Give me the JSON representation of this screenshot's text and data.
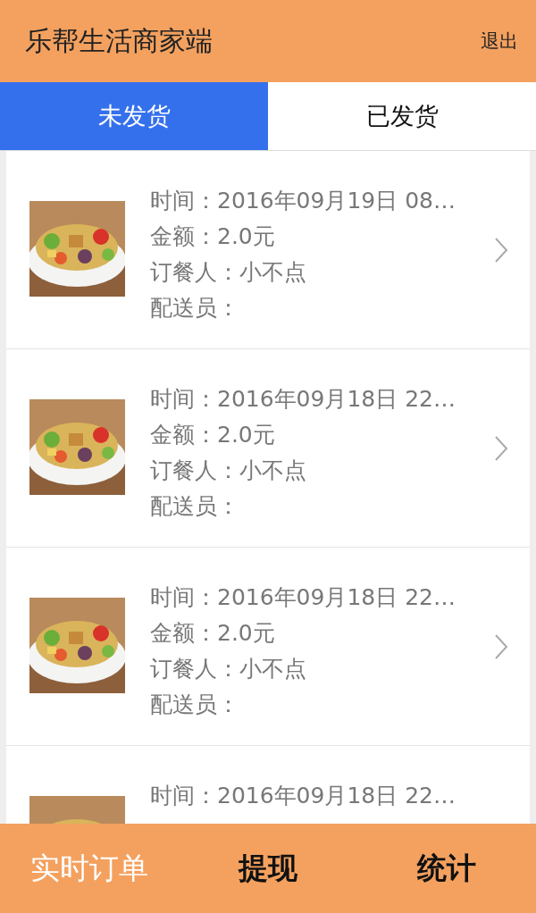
{
  "header": {
    "title": "乐帮生活商家端",
    "action": "退出"
  },
  "tabs": [
    {
      "label": "未发货",
      "selected": true
    },
    {
      "label": "已发货",
      "selected": false
    }
  ],
  "orders": [
    {
      "kind": "picture",
      "lines": [
        "时间：2016年09月19日 08…",
        "金额：2.0元",
        "订餐人：小不点",
        "配送员："
      ]
    },
    {
      "kind": "picture",
      "lines": [
        "时间：2016年09月18日 22…",
        "金额：2.0元",
        "订餐人：小不点",
        "配送员："
      ]
    },
    {
      "kind": "picture",
      "lines": [
        "时间：2016年09月18日 22…",
        "金额：2.0元",
        "订餐人：小不点",
        "配送员："
      ]
    },
    {
      "kind": "picture",
      "lines": [
        "时间：2016年09月18日 22…"
      ]
    }
  ],
  "bottom_nav": [
    {
      "label": "实时订单",
      "selected": true
    },
    {
      "label": "提现",
      "selected": false
    },
    {
      "label": "统计",
      "selected": false
    }
  ]
}
